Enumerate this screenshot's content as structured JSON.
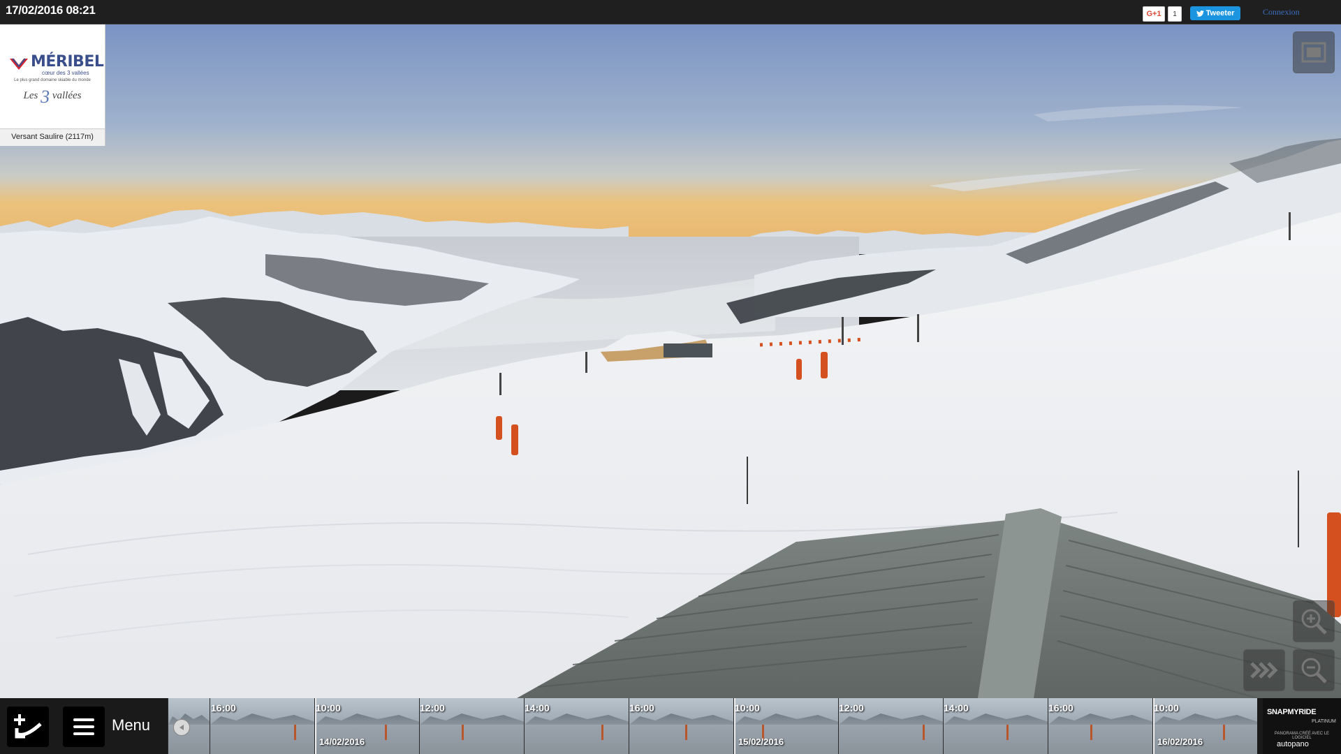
{
  "topbar": {
    "datetime": "17/02/2016 08:21",
    "gplus_label": "G+1",
    "gplus_count": "1",
    "tweet_label": "Tweeter",
    "login_label": "Connexion"
  },
  "logo": {
    "brand": "MÉRIBEL",
    "subtitle": "cœur des 3 vallées",
    "tagline": "Le plus grand domaine skiable du monde",
    "les3_prefix": "Les",
    "les3_number": "3",
    "les3_suffix": "vallées",
    "camera_location": "Versant Saulire (2117m)"
  },
  "controls": {
    "fullscreen_icon": "fullscreen-icon",
    "zoom_in_icon": "zoom-in-icon",
    "zoom_out_icon": "zoom-out-icon",
    "forward_icon": "fast-forward-icon"
  },
  "bottombar": {
    "menu_label": "Menu",
    "timeline": {
      "time_labels": [
        "16:00",
        "10:00",
        "12:00",
        "14:00",
        "16:00",
        "10:00",
        "12:00",
        "14:00",
        "16:00",
        "10:00"
      ],
      "date_labels": [
        "14/02/2016",
        "15/02/2016",
        "16/02/2016"
      ]
    },
    "credits": {
      "brand": "SNAPMYRIDE",
      "edition": "PLATINUM",
      "made_with": "PANORAMA CRÉÉ AVEC LE LOGICIEL",
      "software": "autopano"
    }
  },
  "colors": {
    "sky_top": "#7b94c2",
    "horizon": "#e9c07a",
    "snow": "#f0f1f3",
    "roof": "#6f7774",
    "fence": "#d4501e",
    "link": "#3b6fc4",
    "tweet": "#1b95e0"
  }
}
